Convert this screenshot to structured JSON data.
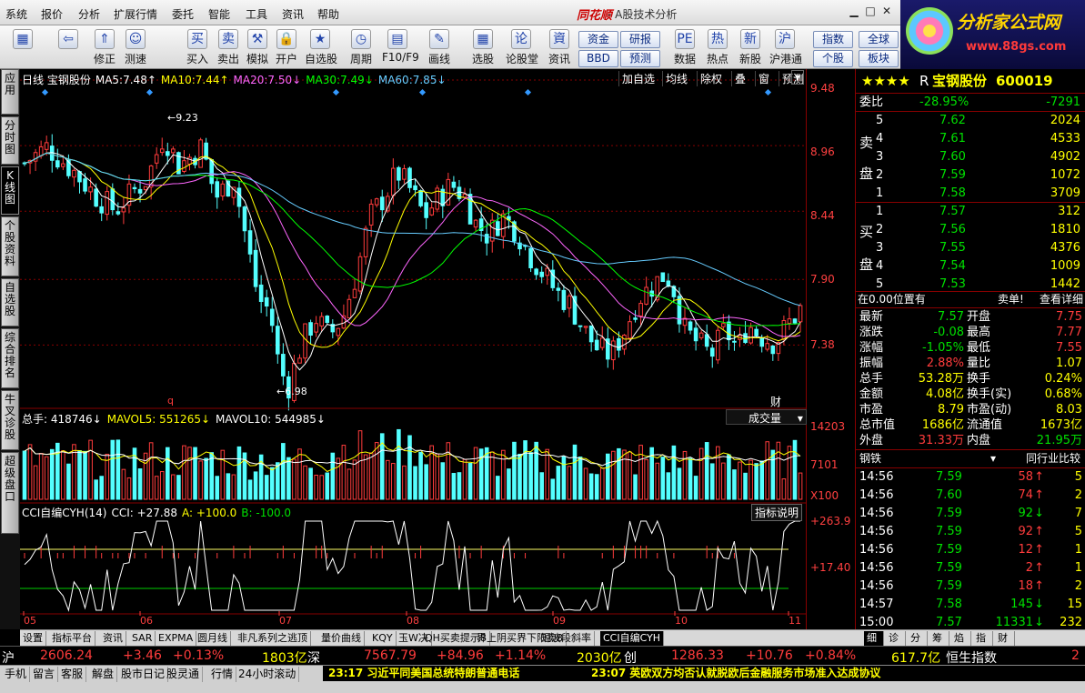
{
  "menu": [
    "系统",
    "报价",
    "分析",
    "扩展行情",
    "委托",
    "智能",
    "工具",
    "资讯",
    "帮助"
  ],
  "app": {
    "brand": "同花顺",
    "title": "- A股技术分析"
  },
  "logo": {
    "name": "分析家公式网",
    "url": "www.88gs.com"
  },
  "toolbar": {
    "buttons": [
      "",
      "",
      "修正",
      "测速",
      "买入",
      "卖出",
      "模拟",
      "开户",
      "自选股",
      "周期",
      "F10/F9",
      "画线",
      "选股",
      "论股堂",
      "资讯",
      "",
      "数据",
      "热点",
      "新股",
      "沪港通"
    ],
    "pairs": [
      "资金",
      "研报",
      "BBD",
      "预测"
    ],
    "right": [
      "指数",
      "全球",
      "个股",
      "板块"
    ]
  },
  "left_tabs": [
    "应用",
    "分时图",
    "K线图",
    "个股资料",
    "自选股",
    "综合排名",
    "牛叉诊股",
    "超级盘口"
  ],
  "chart": {
    "period": "日线",
    "name": "宝钢股份",
    "ma": [
      {
        "label": "MA5:",
        "value": "7.48",
        "color": "#ffffff"
      },
      {
        "label": "MA10:",
        "value": "7.44",
        "color": "#ffff00"
      },
      {
        "label": "MA20:",
        "value": "7.50",
        "color": "#ff66ff"
      },
      {
        "label": "MA30:",
        "value": "7.49",
        "color": "#00ff00"
      },
      {
        "label": "MA60:",
        "value": "7.85",
        "color": "#66ccff"
      }
    ],
    "top_buttons": [
      "加自选",
      "均线",
      "除权",
      "叠",
      "窗",
      "预测"
    ],
    "high_label": "9.23",
    "low_label": "6.98",
    "marker_q": "q",
    "marker_cai": "财",
    "price_axis": [
      "9.48",
      "8.96",
      "8.44",
      "7.90",
      "7.38"
    ],
    "volume": {
      "label": "总手: 418746",
      "mavol5": "MAVOL5: 551265",
      "mavol10": "MAVOL10: 544985",
      "selector": "成交量",
      "axis": [
        "14203",
        "7101",
        "X100"
      ]
    },
    "cci": {
      "title": "CCI自编CYH(14)",
      "cci": "CCI: +27.88",
      "a": "A: +100.0",
      "b": "B: -100.0",
      "button": "指标说明",
      "axis": [
        "+263.9",
        "+17.40"
      ]
    },
    "months": [
      "05",
      "06",
      "07",
      "08",
      "09",
      "10",
      "11"
    ]
  },
  "chart_data": {
    "type": "candlestick",
    "title": "宝钢股份 日线",
    "ylim": [
      6.9,
      9.48
    ],
    "high": 9.23,
    "low": 6.98
  },
  "stock": {
    "stars": "★★★★",
    "tag": "R",
    "name": "宝钢股份",
    "code": "600019",
    "weibi": {
      "label": "委比",
      "pct": "-28.95%",
      "diff": "-7291"
    },
    "sell": [
      [
        "5",
        "7.62",
        "2024"
      ],
      [
        "4",
        "7.61",
        "4533"
      ],
      [
        "3",
        "7.60",
        "4902"
      ],
      [
        "2",
        "7.59",
        "1072"
      ],
      [
        "1",
        "7.58",
        "3709"
      ]
    ],
    "sell_label": [
      "卖",
      "盘"
    ],
    "buy": [
      [
        "1",
        "7.57",
        "312"
      ],
      [
        "2",
        "7.56",
        "1810"
      ],
      [
        "3",
        "7.55",
        "4376"
      ],
      [
        "4",
        "7.54",
        "1009"
      ],
      [
        "5",
        "7.53",
        "1442"
      ]
    ],
    "buy_label": [
      "买",
      "盘"
    ],
    "pos": "在0.00位置有",
    "sell_single": "卖单!",
    "detail": "查看详细",
    "quote": [
      [
        "最新",
        "7.57",
        "开盘",
        "7.75"
      ],
      [
        "涨跌",
        "-0.08",
        "最高",
        "7.77"
      ],
      [
        "涨幅",
        "-1.05%",
        "最低",
        "7.55"
      ],
      [
        "振幅",
        "2.88%",
        "量比",
        "1.07"
      ],
      [
        "总手",
        "53.28万",
        "换手",
        "0.24%"
      ],
      [
        "金额",
        "4.08亿",
        "换手(实)",
        "0.68%"
      ],
      [
        "市盈",
        "8.79",
        "市盈(动)",
        "8.03"
      ],
      [
        "总市值",
        "1686亿",
        "流通值",
        "1673亿"
      ],
      [
        "外盘",
        "31.33万",
        "内盘",
        "21.95万"
      ]
    ],
    "industry": "钢铁",
    "compare": "同行业比较",
    "ticks": [
      [
        "14:56",
        "7.59",
        "58",
        "↑",
        "5"
      ],
      [
        "14:56",
        "7.60",
        "74",
        "↑",
        "2"
      ],
      [
        "14:56",
        "7.59",
        "92",
        "↓",
        "7"
      ],
      [
        "14:56",
        "7.59",
        "92",
        "↑",
        "5"
      ],
      [
        "14:56",
        "7.59",
        "12",
        "↑",
        "1"
      ],
      [
        "14:56",
        "7.59",
        "2",
        "↑",
        "1"
      ],
      [
        "14:56",
        "7.59",
        "18",
        "↑",
        "2"
      ],
      [
        "14:57",
        "7.58",
        "145",
        "↓",
        "15"
      ],
      [
        "15:00",
        "7.57",
        "11331",
        "↓",
        "232"
      ]
    ]
  },
  "bottom_tabs": [
    "设置",
    "指标平台",
    "资讯",
    "SAR",
    "EXPMA",
    "圆月线",
    "非凡系列之逃顶",
    "量价曲线",
    "KQY",
    "玉W决",
    "QH买卖提示8",
    "界上阴买界下阳卖8",
    "短波段斜率",
    "CCI自编CYH"
  ],
  "right_tabs": [
    "细",
    "诊",
    "分",
    "筹",
    "焰",
    "指",
    "财"
  ],
  "ticker": {
    "sh": {
      "name": "沪",
      "val": "2606.24",
      "chg": "+3.46",
      "pct": "+0.13%",
      "amt": "1803亿"
    },
    "sz": {
      "name": "深",
      "val": "7567.79",
      "chg": "+84.96",
      "pct": "+1.14%",
      "amt": "2030亿"
    },
    "cy": {
      "name": "创",
      "val": "1286.33",
      "chg": "+10.76",
      "pct": "+0.84%",
      "amt": "617.7亿"
    },
    "hs": "恒生指数",
    "end": "2"
  },
  "status": [
    "手机",
    "留言",
    "客服",
    "解盘",
    "股市日记",
    "股灵通",
    "行情",
    "24小时滚动"
  ],
  "news": [
    {
      "time": "23:17",
      "text": "习近平同美国总统特朗普通电话"
    },
    {
      "time": "23:07",
      "text": "英欧双方均否认就脱欧后金融服务市场准入达成协议"
    }
  ]
}
